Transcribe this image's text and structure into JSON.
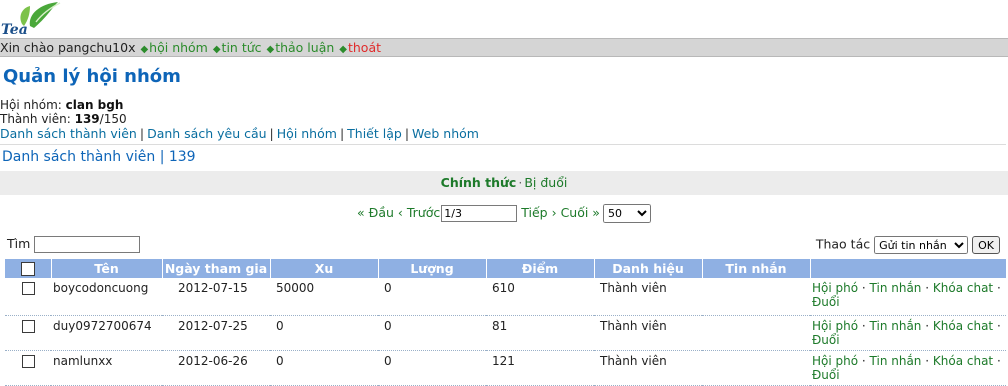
{
  "logo": {
    "text": "Tea"
  },
  "topbar": {
    "greeting": "Xin chào pangchu10x",
    "links": [
      "hội nhóm",
      "tin tức",
      "thảo luận"
    ],
    "logout": "thoát"
  },
  "page": {
    "title": "Quản lý hội nhóm",
    "group_label": "Hội nhóm:",
    "group_name": "clan bgh",
    "members_label": "Thành viên:",
    "members_count": "139",
    "members_max": "/150"
  },
  "subnav": [
    "Danh sách thành viên",
    "Danh sách yêu cầu",
    "Hội nhóm",
    "Thiết lập",
    "Web nhóm"
  ],
  "section_title": "Danh sách thành viên | 139",
  "status_tabs": {
    "active": "Chính thức",
    "other": "Bị đuổi"
  },
  "pager": {
    "first": "« Đầu",
    "prev": "‹ Trước",
    "page_value": "1/3",
    "next": "Tiếp ›",
    "last": "Cuối »",
    "per_page": "50"
  },
  "search": {
    "label": "Tìm",
    "value": ""
  },
  "action": {
    "label": "Thao tác",
    "selected": "Gửi tin nhắn",
    "ok": "OK"
  },
  "table": {
    "columns": [
      "Tên",
      "Ngày tham gia",
      "Xu",
      "Lượng",
      "Điểm",
      "Danh hiệu",
      "Tin nhắn"
    ],
    "actions": {
      "vice": "Hội phó",
      "message": "Tin nhắn",
      "lock": "Khóa chat",
      "kick": "Đuổi"
    },
    "rows": [
      {
        "name": "boycodoncuong",
        "date": "2012-07-15",
        "xu": "50000",
        "luong": "0",
        "diem": "610",
        "title": "Thành viên"
      },
      {
        "name": "duy0972700674",
        "date": "2012-07-25",
        "xu": "0",
        "luong": "0",
        "diem": "81",
        "title": "Thành viên"
      },
      {
        "name": "namlunxx",
        "date": "2012-06-26",
        "xu": "0",
        "luong": "0",
        "diem": "121",
        "title": "Thành viên"
      }
    ]
  },
  "colors": {
    "header_blue": "#8fb0e3",
    "title_blue": "#0e65b8",
    "link_green": "#1d7a2a",
    "logout_red": "#e02b2b"
  }
}
